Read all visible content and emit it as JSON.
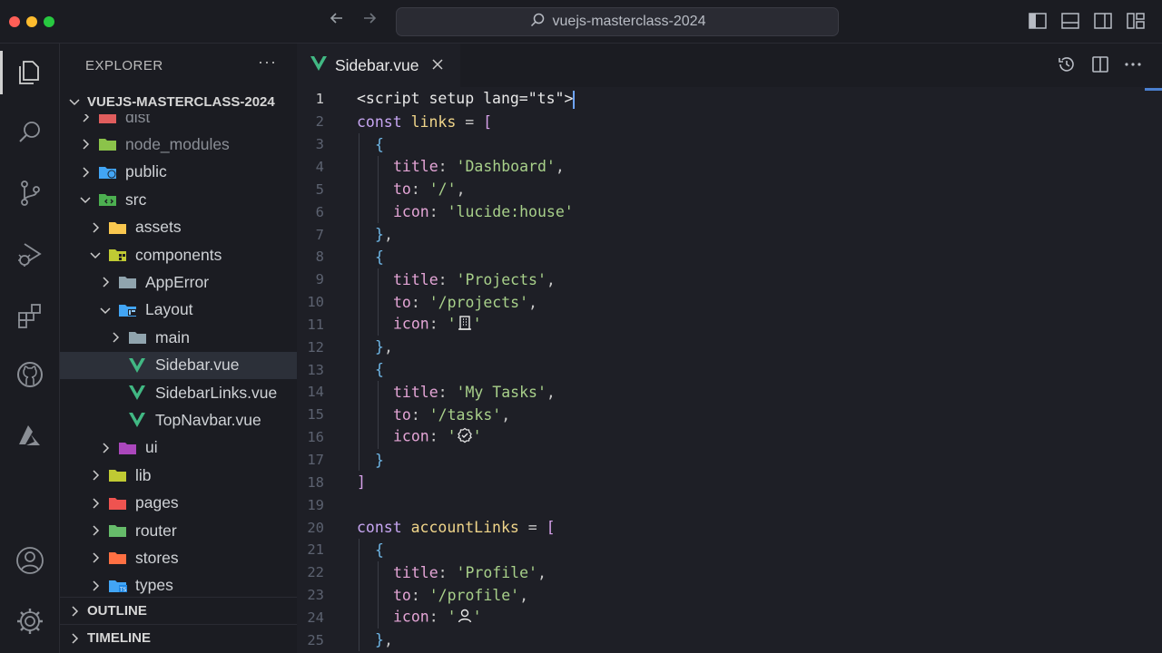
{
  "window": {
    "search_text": "vuejs-masterclass-2024"
  },
  "explorer": {
    "title": "EXPLORER",
    "more": "···",
    "root": "VUEJS-MASTERCLASS-2024",
    "rows": [
      {
        "label": "dist",
        "depth": 1,
        "chevron": "right",
        "icon": "dist-folder-icon",
        "dim": true
      },
      {
        "label": "node_modules",
        "depth": 1,
        "chevron": "right",
        "icon": "node-modules-folder-icon",
        "dim": true
      },
      {
        "label": "public",
        "depth": 1,
        "chevron": "right",
        "icon": "public-folder-icon"
      },
      {
        "label": "src",
        "depth": 1,
        "chevron": "down",
        "icon": "src-folder-icon"
      },
      {
        "label": "assets",
        "depth": 2,
        "chevron": "right",
        "icon": "assets-folder-icon"
      },
      {
        "label": "components",
        "depth": 2,
        "chevron": "down",
        "icon": "components-folder-icon"
      },
      {
        "label": "AppError",
        "depth": 3,
        "chevron": "right",
        "icon": "folder-icon"
      },
      {
        "label": "Layout",
        "depth": 3,
        "chevron": "down",
        "icon": "layout-folder-icon"
      },
      {
        "label": "main",
        "depth": 4,
        "chevron": "right",
        "icon": "folder-icon"
      },
      {
        "label": "Sidebar.vue",
        "depth": 4,
        "chevron": "none",
        "icon": "vue-file-icon",
        "selected": true
      },
      {
        "label": "SidebarLinks.vue",
        "depth": 4,
        "chevron": "none",
        "icon": "vue-file-icon"
      },
      {
        "label": "TopNavbar.vue",
        "depth": 4,
        "chevron": "none",
        "icon": "vue-file-icon"
      },
      {
        "label": "ui",
        "depth": 3,
        "chevron": "right",
        "icon": "ui-folder-icon"
      },
      {
        "label": "lib",
        "depth": 2,
        "chevron": "right",
        "icon": "lib-folder-icon"
      },
      {
        "label": "pages",
        "depth": 2,
        "chevron": "right",
        "icon": "pages-folder-icon"
      },
      {
        "label": "router",
        "depth": 2,
        "chevron": "right",
        "icon": "router-folder-icon"
      },
      {
        "label": "stores",
        "depth": 2,
        "chevron": "right",
        "icon": "stores-folder-icon"
      },
      {
        "label": "types",
        "depth": 2,
        "chevron": "right",
        "icon": "types-folder-icon"
      }
    ],
    "outline": "OUTLINE",
    "timeline": "TIMELINE"
  },
  "editor": {
    "tab_label": "Sidebar.vue",
    "current_line": 1,
    "lines": [
      {
        "n": "1",
        "indent": 0,
        "tokens": [
          [
            "tag",
            "<script setup lang=\"ts\">"
          ]
        ],
        "cursor": true
      },
      {
        "n": "2",
        "indent": 0,
        "tokens": [
          [
            "kw",
            "const "
          ],
          [
            "var",
            "links"
          ],
          [
            "pun",
            " = "
          ],
          [
            "br1",
            "["
          ]
        ]
      },
      {
        "n": "3",
        "indent": 1,
        "tokens": [
          [
            "br2",
            "{"
          ]
        ]
      },
      {
        "n": "4",
        "indent": 2,
        "tokens": [
          [
            "prop",
            "title"
          ],
          [
            "pun",
            ": "
          ],
          [
            "str",
            "'Dashboard'"
          ],
          [
            "pun",
            ","
          ]
        ]
      },
      {
        "n": "5",
        "indent": 2,
        "tokens": [
          [
            "prop",
            "to"
          ],
          [
            "pun",
            ": "
          ],
          [
            "str",
            "'/'"
          ],
          [
            "pun",
            ","
          ]
        ]
      },
      {
        "n": "6",
        "indent": 2,
        "tokens": [
          [
            "prop",
            "icon"
          ],
          [
            "pun",
            ": "
          ],
          [
            "str",
            "'lucide:house'"
          ]
        ]
      },
      {
        "n": "7",
        "indent": 1,
        "tokens": [
          [
            "br2",
            "}"
          ],
          [
            "pun",
            ","
          ]
        ]
      },
      {
        "n": "8",
        "indent": 1,
        "tokens": [
          [
            "br2",
            "{"
          ]
        ]
      },
      {
        "n": "9",
        "indent": 2,
        "tokens": [
          [
            "prop",
            "title"
          ],
          [
            "pun",
            ": "
          ],
          [
            "str",
            "'Projects'"
          ],
          [
            "pun",
            ","
          ]
        ]
      },
      {
        "n": "10",
        "indent": 2,
        "tokens": [
          [
            "prop",
            "to"
          ],
          [
            "pun",
            ": "
          ],
          [
            "str",
            "'/projects'"
          ],
          [
            "pun",
            ","
          ]
        ]
      },
      {
        "n": "11",
        "indent": 2,
        "tokens": [
          [
            "prop",
            "icon"
          ],
          [
            "pun",
            ": "
          ],
          [
            "str",
            "'"
          ],
          [
            "icon",
            "building-icon"
          ],
          [
            "str",
            "'"
          ]
        ]
      },
      {
        "n": "12",
        "indent": 1,
        "tokens": [
          [
            "br2",
            "}"
          ],
          [
            "pun",
            ","
          ]
        ]
      },
      {
        "n": "13",
        "indent": 1,
        "tokens": [
          [
            "br2",
            "{"
          ]
        ]
      },
      {
        "n": "14",
        "indent": 2,
        "tokens": [
          [
            "prop",
            "title"
          ],
          [
            "pun",
            ": "
          ],
          [
            "str",
            "'My Tasks'"
          ],
          [
            "pun",
            ","
          ]
        ]
      },
      {
        "n": "15",
        "indent": 2,
        "tokens": [
          [
            "prop",
            "to"
          ],
          [
            "pun",
            ": "
          ],
          [
            "str",
            "'/tasks'"
          ],
          [
            "pun",
            ","
          ]
        ]
      },
      {
        "n": "16",
        "indent": 2,
        "tokens": [
          [
            "prop",
            "icon"
          ],
          [
            "pun",
            ": "
          ],
          [
            "str",
            "'"
          ],
          [
            "icon",
            "badge-check-icon"
          ],
          [
            "str",
            "'"
          ]
        ]
      },
      {
        "n": "17",
        "indent": 1,
        "tokens": [
          [
            "br2",
            "}"
          ]
        ]
      },
      {
        "n": "18",
        "indent": 0,
        "tokens": [
          [
            "br1",
            "]"
          ]
        ]
      },
      {
        "n": "19",
        "indent": 0,
        "tokens": []
      },
      {
        "n": "20",
        "indent": 0,
        "tokens": [
          [
            "kw",
            "const "
          ],
          [
            "var",
            "accountLinks"
          ],
          [
            "pun",
            " = "
          ],
          [
            "br1",
            "["
          ]
        ]
      },
      {
        "n": "21",
        "indent": 1,
        "tokens": [
          [
            "br2",
            "{"
          ]
        ]
      },
      {
        "n": "22",
        "indent": 2,
        "tokens": [
          [
            "prop",
            "title"
          ],
          [
            "pun",
            ": "
          ],
          [
            "str",
            "'Profile'"
          ],
          [
            "pun",
            ","
          ]
        ]
      },
      {
        "n": "23",
        "indent": 2,
        "tokens": [
          [
            "prop",
            "to"
          ],
          [
            "pun",
            ": "
          ],
          [
            "str",
            "'/profile'"
          ],
          [
            "pun",
            ","
          ]
        ]
      },
      {
        "n": "24",
        "indent": 2,
        "tokens": [
          [
            "prop",
            "icon"
          ],
          [
            "pun",
            ": "
          ],
          [
            "str",
            "'"
          ],
          [
            "icon",
            "user-icon"
          ],
          [
            "str",
            "'"
          ]
        ]
      },
      {
        "n": "25",
        "indent": 1,
        "tokens": [
          [
            "br2",
            "}"
          ],
          [
            "pun",
            ","
          ]
        ]
      }
    ]
  },
  "colors": {
    "accent": "#4a7fd0",
    "vue_green": "#41b883"
  }
}
